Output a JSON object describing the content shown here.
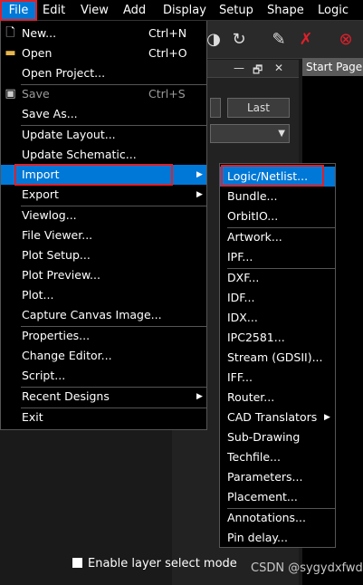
{
  "menubar": {
    "items": [
      "File",
      "Edit",
      "View",
      "Add",
      "Display",
      "Setup",
      "Shape",
      "Logic"
    ]
  },
  "panel": {
    "last_button": "Last",
    "close_symbol": "✕",
    "restore_symbol": "🗗",
    "min_symbol": "—"
  },
  "start_tab": "Start Page",
  "file_menu": {
    "items": [
      {
        "label": "New...",
        "shortcut": "Ctrl+N",
        "icon": "new-file-icon"
      },
      {
        "label": "Open",
        "shortcut": "Ctrl+O",
        "icon": "open-folder-icon"
      },
      {
        "label": "Open Project..."
      },
      {
        "label": "Save",
        "shortcut": "Ctrl+S",
        "icon": "save-icon",
        "disabled": true
      },
      {
        "label": "Save As..."
      },
      {
        "label": "Update Layout..."
      },
      {
        "label": "Update Schematic..."
      },
      {
        "label": "Import",
        "submenu": true,
        "active": true
      },
      {
        "label": "Export",
        "submenu": true
      },
      {
        "label": "Viewlog..."
      },
      {
        "label": "File Viewer..."
      },
      {
        "label": "Plot Setup..."
      },
      {
        "label": "Plot Preview..."
      },
      {
        "label": "Plot..."
      },
      {
        "label": "Capture Canvas Image..."
      },
      {
        "label": "Properties..."
      },
      {
        "label": "Change Editor..."
      },
      {
        "label": "Script..."
      },
      {
        "label": "Recent Designs",
        "submenu": true
      },
      {
        "label": "Exit"
      }
    ]
  },
  "import_menu": {
    "items": [
      {
        "label": "Logic/Netlist...",
        "active": true
      },
      {
        "label": "Bundle..."
      },
      {
        "label": "OrbitIO..."
      },
      {
        "label": "Artwork..."
      },
      {
        "label": "IPF..."
      },
      {
        "label": "DXF..."
      },
      {
        "label": "IDF..."
      },
      {
        "label": "IDX..."
      },
      {
        "label": "IPC2581..."
      },
      {
        "label": "Stream (GDSII)..."
      },
      {
        "label": "IFF..."
      },
      {
        "label": "Router..."
      },
      {
        "label": "CAD Translators",
        "submenu": true
      },
      {
        "label": "Sub-Drawing"
      },
      {
        "label": "Techfile..."
      },
      {
        "label": "Parameters..."
      },
      {
        "label": "Placement..."
      },
      {
        "label": "Annotations..."
      },
      {
        "label": "Pin delay..."
      }
    ]
  },
  "enable_layer": "Enable layer select mode",
  "watermark": "CSDN @sygydxfwd",
  "colors": {
    "highlight": "#0078d7",
    "annotation_red": "#e0202a"
  }
}
